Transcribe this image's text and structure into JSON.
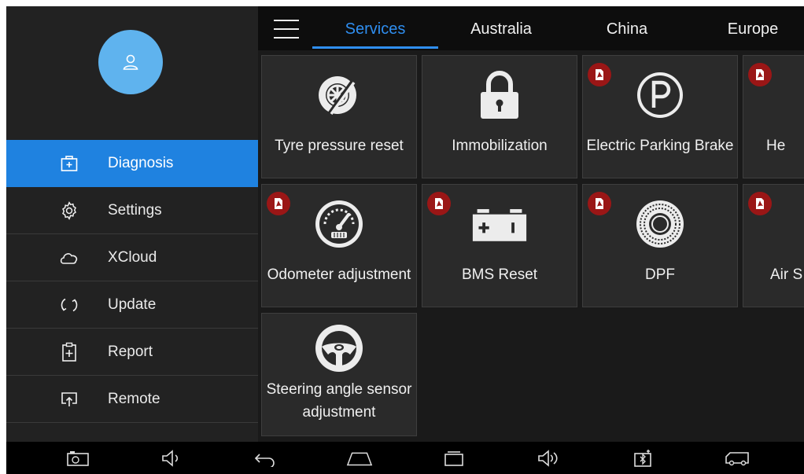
{
  "sidebar": {
    "items": [
      {
        "label": "Diagnosis",
        "icon": "toolbox-icon",
        "active": true
      },
      {
        "label": "Settings",
        "icon": "gear-icon"
      },
      {
        "label": "XCloud",
        "icon": "cloud-icon"
      },
      {
        "label": "Update",
        "icon": "refresh-icon"
      },
      {
        "label": "Report",
        "icon": "report-icon"
      },
      {
        "label": "Remote",
        "icon": "remote-icon"
      }
    ]
  },
  "topbar": {
    "tabs": [
      {
        "label": "Services",
        "active": true
      },
      {
        "label": "Australia"
      },
      {
        "label": "China"
      },
      {
        "label": "Europe"
      }
    ]
  },
  "tiles": [
    {
      "label": "Tyre pressure reset",
      "icon": "tyre-icon",
      "pdf": false
    },
    {
      "label": "Immobilization",
      "icon": "lock-icon",
      "pdf": false
    },
    {
      "label": "Electric Parking Brake",
      "icon": "parking-brake-icon",
      "pdf": true
    },
    {
      "label": "He",
      "icon": "headlight-icon",
      "pdf": true
    },
    {
      "label": "Odometer adjustment",
      "icon": "odometer-icon",
      "pdf": true
    },
    {
      "label": "BMS Reset",
      "icon": "battery-icon",
      "pdf": true
    },
    {
      "label": "DPF",
      "icon": "dpf-filter-icon",
      "pdf": true
    },
    {
      "label": "Air S",
      "icon": "air-suspension-icon",
      "pdf": true
    },
    {
      "label": "Steering angle sensor adjustment",
      "icon": "steering-wheel-icon",
      "pdf": false
    }
  ],
  "bottombar": {
    "buttons": [
      "camera-icon",
      "volume-down-icon",
      "back-icon",
      "home-icon",
      "recents-icon",
      "volume-up-icon",
      "bluetooth-device-icon",
      "vehicle-icon"
    ]
  },
  "colors": {
    "accent": "#1f82e0",
    "tab_active": "#2f8ef0",
    "avatar": "#5fb3ee",
    "pdf_badge": "#9a1616"
  }
}
